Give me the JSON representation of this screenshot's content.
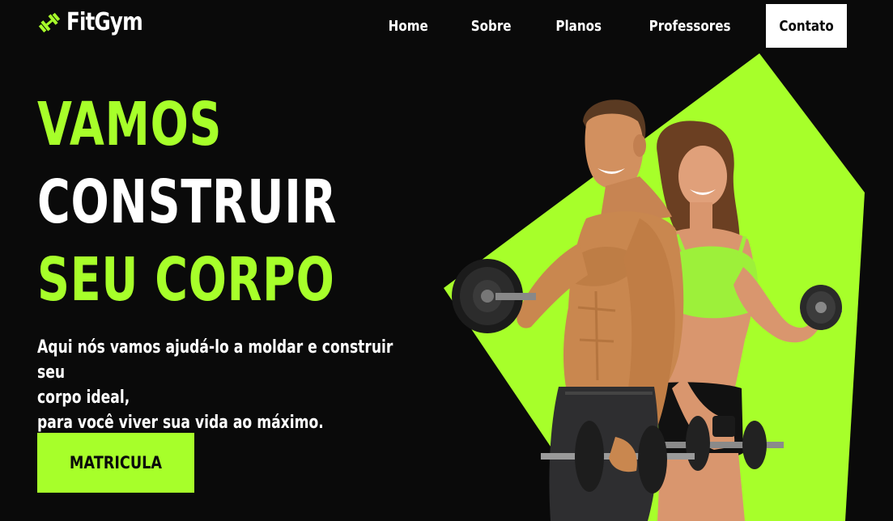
{
  "brand": {
    "name": "FitGym",
    "icon": "dumbbell-icon"
  },
  "nav": {
    "items": [
      {
        "label": "Home"
      },
      {
        "label": "Sobre"
      },
      {
        "label": "Planos"
      },
      {
        "label": "Professores"
      }
    ],
    "contact_label": "Contato"
  },
  "hero": {
    "headline": [
      "VAMOS",
      "CONSTRUIR",
      "SEU CORPO"
    ],
    "description": [
      "Aqui nós vamos ajudá-lo a moldar e construir seu",
      "corpo ideal,",
      "para você viver sua vida ao máximo."
    ],
    "cta_label": "MATRICULA"
  },
  "colors": {
    "accent": "#a7ff2a",
    "background": "#0a0a0a",
    "text": "#ffffff"
  }
}
